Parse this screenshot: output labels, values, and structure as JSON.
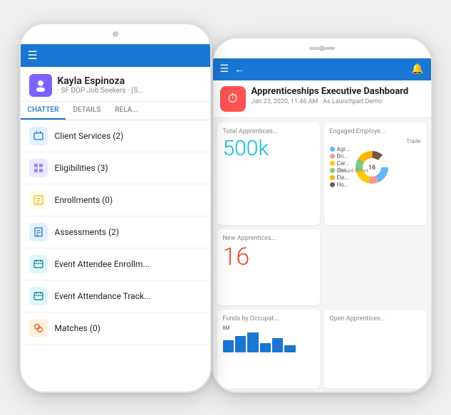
{
  "scene": {
    "background": "#f0f0f0"
  },
  "front_phone": {
    "header": {
      "hamburger": "☰"
    },
    "profile": {
      "name": "Kayla Espinoza",
      "sub": "· SF DOP Job Seekers · (S...",
      "avatar_icon": "👤"
    },
    "tabs": [
      {
        "label": "CHATTER",
        "active": true
      },
      {
        "label": "DETAILS",
        "active": false
      },
      {
        "label": "RELA...",
        "active": false
      }
    ],
    "menu_items": [
      {
        "label": "Client Services (2)",
        "icon_type": "blue",
        "icon": "☰"
      },
      {
        "label": "Eligibilities (3)",
        "icon_type": "purple",
        "icon": "⊞"
      },
      {
        "label": "Enrollments (0)",
        "icon_type": "yellow",
        "icon": "▦"
      },
      {
        "label": "Assessments (2)",
        "icon_type": "blue",
        "icon": "☐"
      },
      {
        "label": "Event Attendee Enrollm...",
        "icon_type": "teal",
        "icon": "⊡"
      },
      {
        "label": "Event Attendance Track...",
        "icon_type": "teal",
        "icon": "⊡"
      },
      {
        "label": "Matches (0)",
        "icon_type": "orange",
        "icon": "●"
      }
    ]
  },
  "back_phone": {
    "header": {
      "hamburger": "☰",
      "back": "←",
      "bell": "🔔"
    },
    "title_section": {
      "app_icon": "⏱",
      "title": "Apprenticeships Executive Dashboard",
      "subtitle": "Jan 23, 2020, 11:46 AM · As Launchpad Demo"
    },
    "cards": [
      {
        "id": "total",
        "title": "Total Apprentices...",
        "value": "500k",
        "color": "teal"
      },
      {
        "id": "engaged",
        "title": "Engaged Employe...",
        "trade_label": "Trade",
        "legend": [
          {
            "label": "Agr...",
            "color": "#64b5f6"
          },
          {
            "label": "Bri...",
            "color": "#ef9a9a"
          },
          {
            "label": "Car...",
            "color": "#ffcc02"
          },
          {
            "label": "Civi...",
            "color": "#81c784"
          },
          {
            "label": "Ele...",
            "color": "#ffb300"
          },
          {
            "label": "Ho...",
            "color": "#795548"
          }
        ],
        "donut": {
          "center_label": "16",
          "segments": [
            {
              "color": "#64b5f6",
              "pct": 18
            },
            {
              "color": "#ef9a9a",
              "pct": 12
            },
            {
              "color": "#ffcc02",
              "pct": 22
            },
            {
              "color": "#81c784",
              "pct": 15
            },
            {
              "color": "#ffb300",
              "pct": 20
            },
            {
              "color": "#795548",
              "pct": 13
            }
          ]
        }
      },
      {
        "id": "new",
        "title": "New Apprentices...",
        "value": "16",
        "color": "red"
      },
      {
        "id": "funds",
        "title": "Funds by Occupat...",
        "bar_label": "8M"
      },
      {
        "id": "open",
        "title": "Open Apprentices...",
        "value": ""
      }
    ]
  }
}
